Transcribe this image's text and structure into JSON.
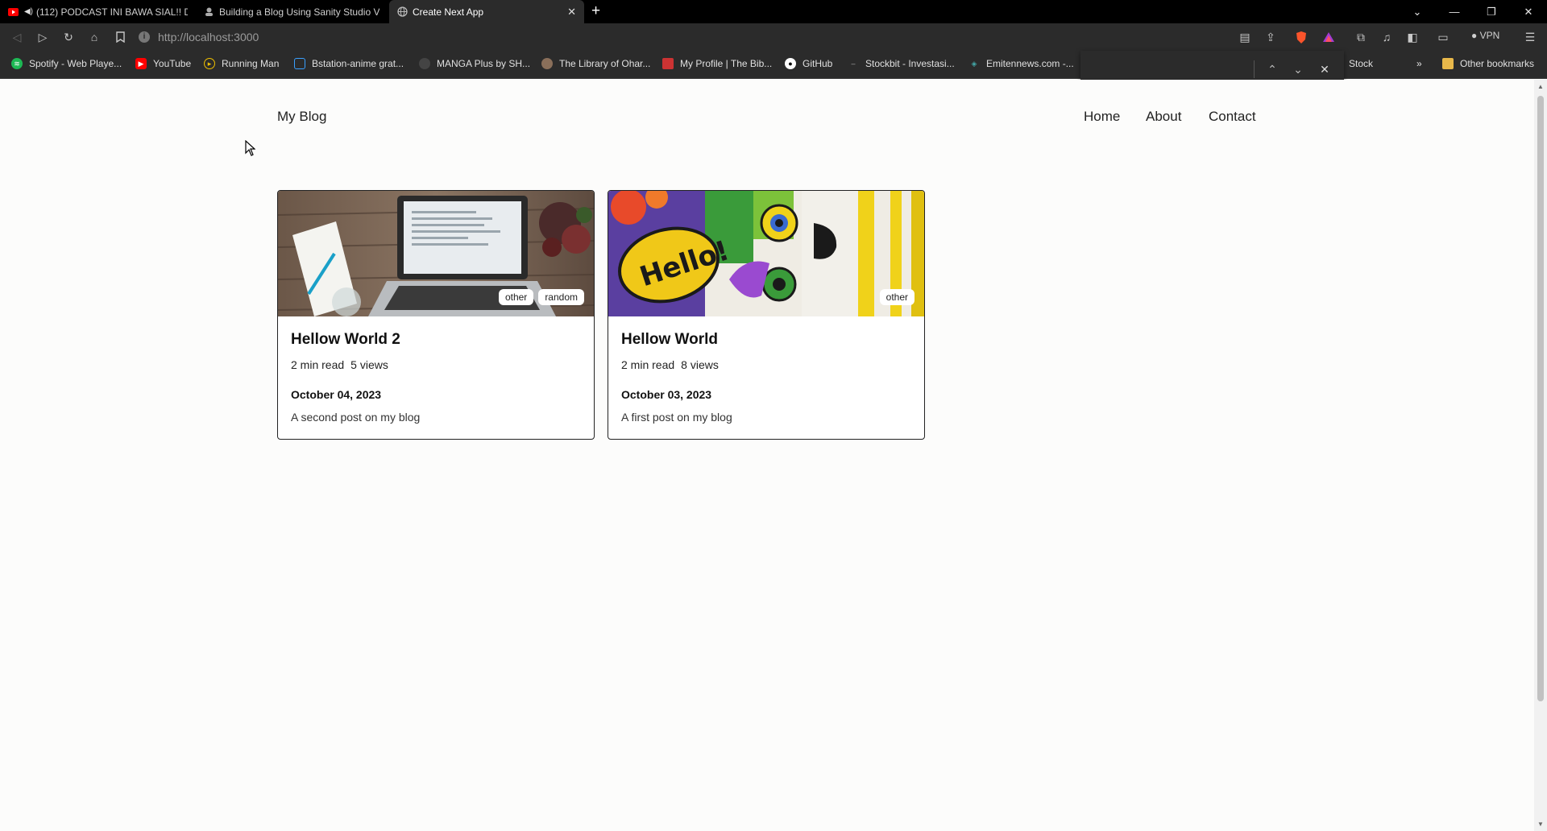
{
  "tabs": [
    {
      "label": "(112) PODCAST INI BAWA SIAL!! D",
      "active": false,
      "audio": true
    },
    {
      "label": "Building a Blog Using Sanity Studio V",
      "active": false
    },
    {
      "label": "Create Next App",
      "active": true
    }
  ],
  "address": {
    "url": "http://localhost:3000"
  },
  "toolbar": {
    "vpn": "VPN"
  },
  "bookmarks": [
    "Spotify - Web Playe...",
    "YouTube",
    "Running Man",
    "Bstation-anime grat...",
    "MANGA Plus by SH...",
    "The Library of Ohar...",
    "My Profile | The Bib...",
    "GitHub",
    "Stockbit - Investasi...",
    "Emitennews.com -...",
    "Stock"
  ],
  "other_bookmarks": "Other bookmarks",
  "site": {
    "brand": "My Blog",
    "nav": [
      "Home",
      "About",
      "Contact"
    ]
  },
  "posts": [
    {
      "title": "Hellow World 2",
      "read_time": "2 min read",
      "views": "5 views",
      "date": "October 04, 2023",
      "description": "A second post on my blog",
      "tags": [
        "other",
        "random"
      ]
    },
    {
      "title": "Hellow World",
      "read_time": "2 min read",
      "views": "8 views",
      "date": "October 03, 2023",
      "description": "A first post on my blog",
      "tags": [
        "other"
      ]
    }
  ],
  "colors": {
    "accent": "#222222",
    "chrome": "#2b2b2b",
    "tabbar": "#000000"
  }
}
